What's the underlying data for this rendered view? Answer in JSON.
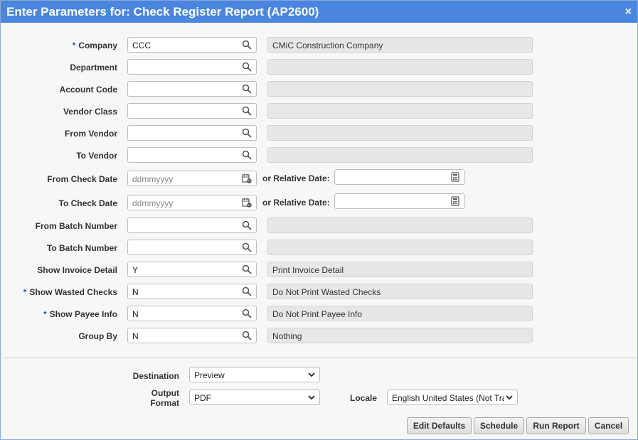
{
  "window": {
    "title": "Enter Parameters for: Check Register Report (AP2600)",
    "close_label": "×"
  },
  "fields": [
    {
      "label": "Company",
      "required": true,
      "value": "CCC",
      "description": "CMiC Construction Company"
    },
    {
      "label": "Department",
      "required": false,
      "value": "",
      "description": ""
    },
    {
      "label": "Account Code",
      "required": false,
      "value": "",
      "description": ""
    },
    {
      "label": "Vendor Class",
      "required": false,
      "value": "",
      "description": ""
    },
    {
      "label": "From Vendor",
      "required": false,
      "value": "",
      "description": ""
    },
    {
      "label": "To Vendor",
      "required": false,
      "value": "",
      "description": ""
    }
  ],
  "dates": [
    {
      "label": "From Check Date",
      "placeholder": "ddmmyyyy",
      "relative_label": "or Relative Date:",
      "relative_value": ""
    },
    {
      "label": "To Check Date",
      "placeholder": "ddmmyyyy",
      "relative_label": "or Relative Date:",
      "relative_value": ""
    }
  ],
  "fields2": [
    {
      "label": "From Batch Number",
      "required": false,
      "value": "",
      "description": ""
    },
    {
      "label": "To Batch Number",
      "required": false,
      "value": "",
      "description": ""
    },
    {
      "label": "Show Invoice Detail",
      "required": false,
      "value": "Y",
      "description": "Print Invoice Detail"
    },
    {
      "label": "Show Wasted Checks",
      "required": true,
      "value": "N",
      "description": "Do Not Print Wasted Checks"
    },
    {
      "label": "Show Payee Info",
      "required": true,
      "value": "N",
      "description": "Do Not Print Payee Info"
    },
    {
      "label": "Group By",
      "required": false,
      "value": "N",
      "description": "Nothing"
    }
  ],
  "required_mark": "*",
  "output": {
    "destination_label": "Destination",
    "destination_value": "Preview",
    "format_label_line1": "Output",
    "format_label_line2": "Format",
    "format_value": "PDF",
    "locale_label": "Locale",
    "locale_value": "English United States (Not Tra"
  },
  "buttons": {
    "edit_defaults": "Edit Defaults",
    "schedule": "Schedule",
    "run_report": "Run Report",
    "cancel": "Cancel"
  },
  "icons": {
    "lookup": "search-icon",
    "date": "calendar-icon",
    "relative_date": "calculator-icon",
    "dropdown": "chevron-down-icon"
  }
}
